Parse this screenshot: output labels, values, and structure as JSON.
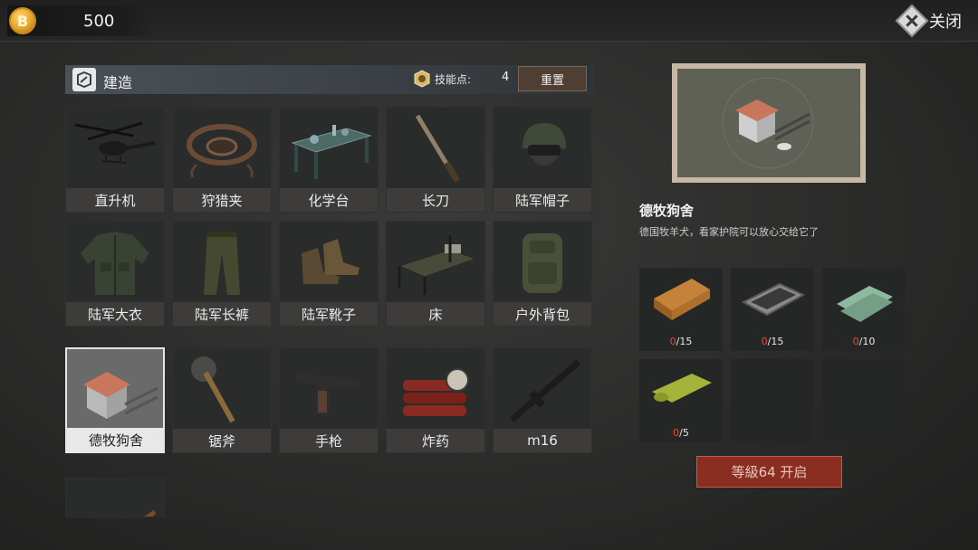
{
  "currency": {
    "icon": "coin-icon",
    "symbol": "B",
    "amount": "500"
  },
  "close": {
    "label": "关闭",
    "icon": "close-icon"
  },
  "build": {
    "title": "建造",
    "skill_points_label": "技能点:",
    "skill_points_value": "4",
    "reset_label": "重置"
  },
  "items": [
    {
      "label": "直升机",
      "icon": "helicopter-icon"
    },
    {
      "label": "狩猎夹",
      "icon": "bear-trap-icon"
    },
    {
      "label": "化学台",
      "icon": "chemistry-table-icon"
    },
    {
      "label": "长刀",
      "icon": "machete-icon"
    },
    {
      "label": "陆军帽子",
      "icon": "army-helmet-icon"
    },
    {
      "label": "陆军大衣",
      "icon": "army-coat-icon"
    },
    {
      "label": "陆军长裤",
      "icon": "army-pants-icon"
    },
    {
      "label": "陆军靴子",
      "icon": "army-boots-icon"
    },
    {
      "label": "床",
      "icon": "bed-icon"
    },
    {
      "label": "户外背包",
      "icon": "backpack-icon"
    },
    {
      "label": "德牧狗舍",
      "icon": "doghouse-icon",
      "selected": true
    },
    {
      "label": "锯斧",
      "icon": "saw-axe-icon"
    },
    {
      "label": "手枪",
      "icon": "pistol-icon"
    },
    {
      "label": "炸药",
      "icon": "dynamite-icon"
    },
    {
      "label": "m16",
      "icon": "rifle-icon"
    },
    {
      "label": "",
      "icon": "rifle-partial-icon"
    }
  ],
  "detail": {
    "title": "德牧狗舍",
    "description": "德国牧羊犬，看家护院可以放心交给它了",
    "materials": [
      {
        "icon": "wood-plank-icon",
        "have": "0",
        "need": "/15"
      },
      {
        "icon": "metal-plate-icon",
        "have": "0",
        "need": "/15"
      },
      {
        "icon": "cloth-icon",
        "have": "0",
        "need": "/10"
      },
      {
        "icon": "rope-mat-icon",
        "have": "0",
        "need": "/5"
      },
      {
        "icon": "",
        "have": "",
        "need": ""
      },
      {
        "icon": "",
        "have": "",
        "need": ""
      }
    ],
    "unlock_label": "等級64 开启"
  },
  "colors": {
    "accent_red": "#8a2e22",
    "count_red": "#e34b3a",
    "preview_frame": "#c6b8a4"
  }
}
